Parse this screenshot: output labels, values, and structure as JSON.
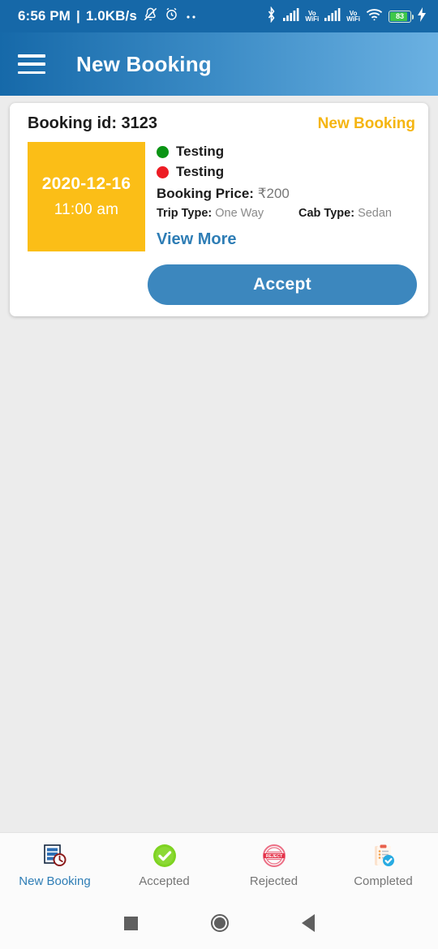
{
  "status_bar": {
    "time": "6:56 PM",
    "separator": "|",
    "network_speed": "1.0KB/s",
    "battery_percent": "83",
    "icons": {
      "silent": "bell-off-icon",
      "alarm": "alarm-clock-icon",
      "more": "more-dots-icon",
      "bluetooth": "bluetooth-icon",
      "signal1": "signal-bars-icon",
      "vowifi1": "vowifi-icon",
      "signal2": "signal-bars-icon",
      "vowifi2": "vowifi-icon",
      "wifi": "wifi-icon",
      "battery": "battery-icon",
      "charging": "charging-bolt-icon"
    },
    "vowifi_top": "Vo",
    "vowifi_bottom": "WiFi"
  },
  "app_bar": {
    "menu_icon": "hamburger-menu-icon",
    "title": "New Booking"
  },
  "booking_card": {
    "booking_id_label": "Booking id: 3123",
    "status_tag": "New Booking",
    "date": "2020-12-16",
    "time": "11:00 am",
    "pickup_location": "Testing",
    "drop_location": "Testing",
    "price_label": "Booking Price:",
    "price_value": "₹200",
    "trip_type_label": "Trip Type:",
    "trip_type_value": "One Way",
    "cab_type_label": "Cab Type:",
    "cab_type_value": "Sedan",
    "view_more_label": "View More",
    "accept_label": "Accept",
    "colors": {
      "date_box": "#FBBE17",
      "tag": "#F5B512",
      "accept_button": "#3C87BE",
      "link": "#2E7DB5",
      "pickup_dot": "#0A9414",
      "drop_dot": "#ED1C24"
    }
  },
  "bottom_nav": {
    "items": [
      {
        "label": "New Booking",
        "icon": "booking-list-clock-icon",
        "active": true
      },
      {
        "label": "Accepted",
        "icon": "green-check-circle-icon",
        "active": false
      },
      {
        "label": "Rejected",
        "icon": "red-rejected-stamp-icon",
        "active": false
      },
      {
        "label": "Completed",
        "icon": "clipboard-check-icon",
        "active": false
      }
    ],
    "active_color": "#2E7DB5",
    "inactive_color": "#767676"
  },
  "android_nav": {
    "recents": "recents-square-icon",
    "home": "home-circle-icon",
    "back": "back-triangle-icon"
  }
}
